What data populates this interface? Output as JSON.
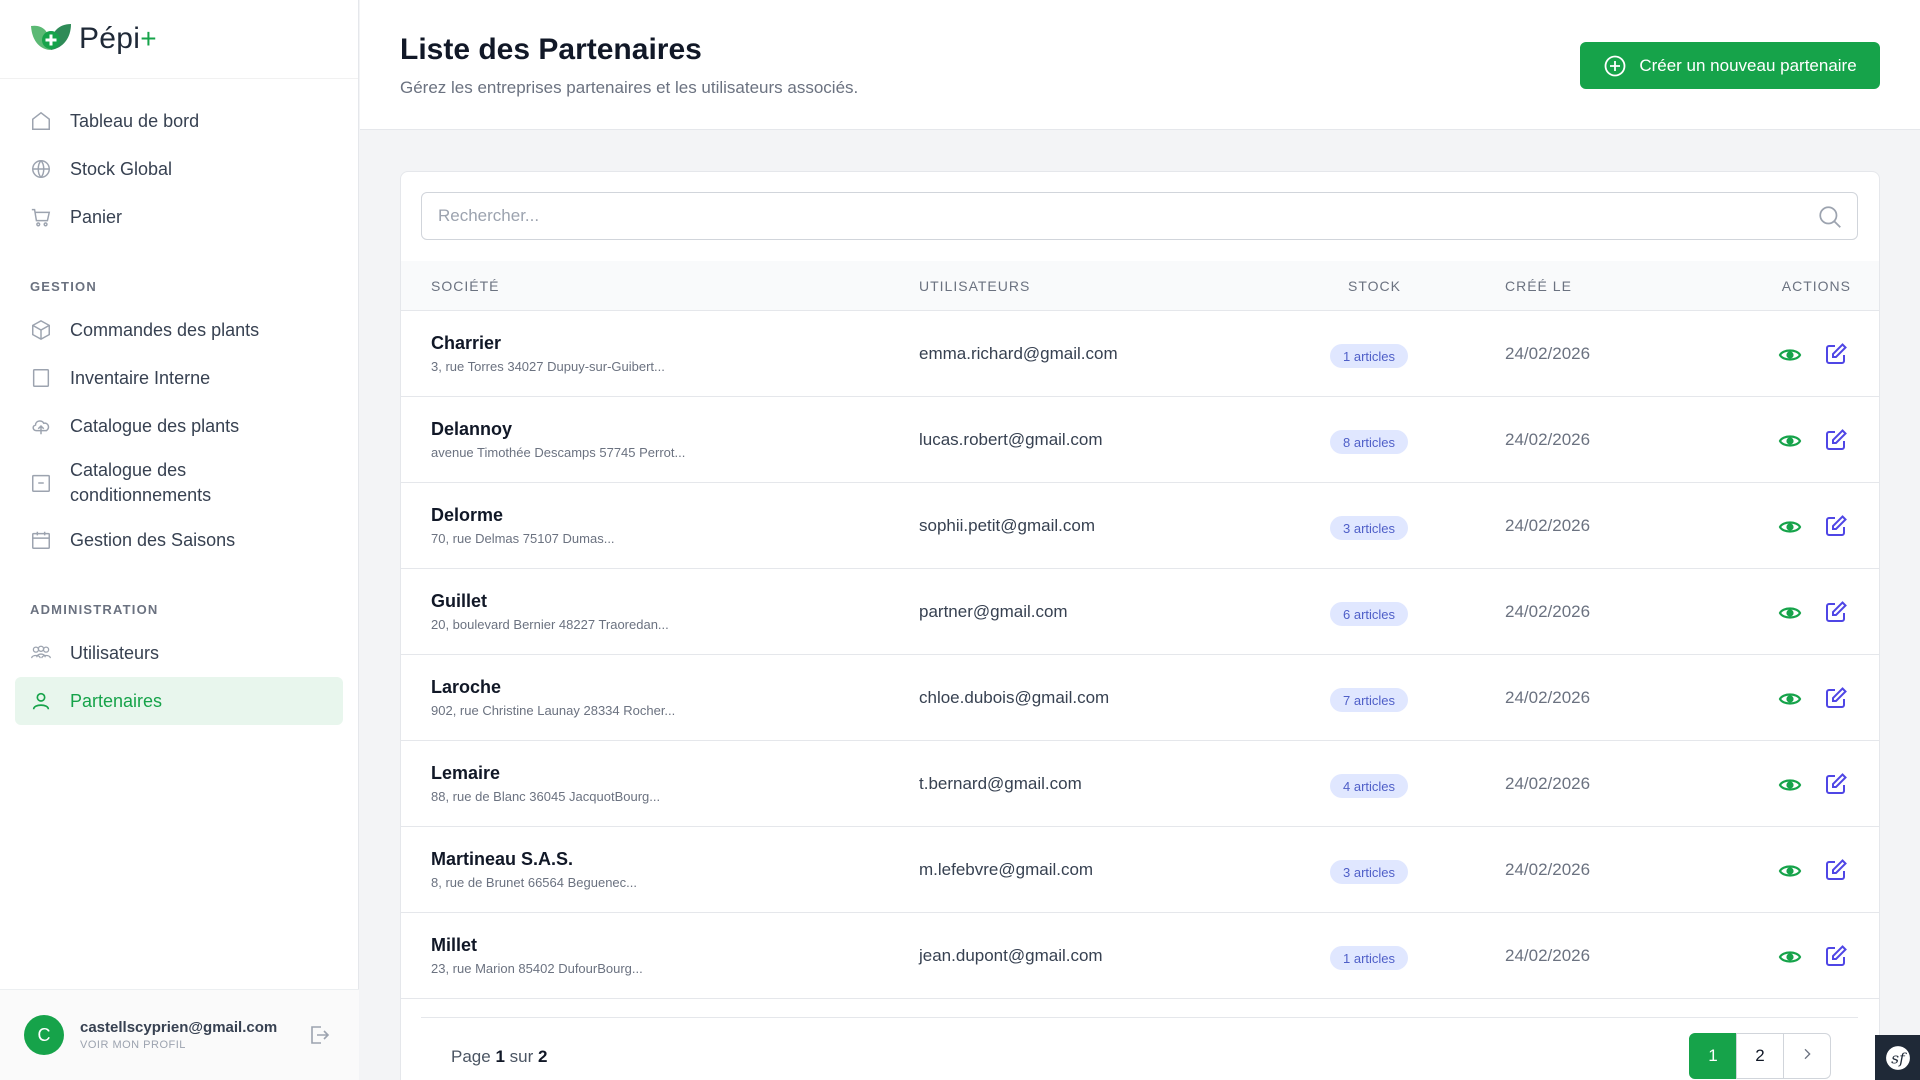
{
  "app": {
    "logo_text": "Pépi",
    "logo_plus": "+"
  },
  "sidebar": {
    "main_items": [
      {
        "label": "Tableau de bord",
        "icon": "home-icon"
      },
      {
        "label": "Stock Global",
        "icon": "globe-icon"
      },
      {
        "label": "Panier",
        "icon": "cart-icon"
      }
    ],
    "section_gestion": "GESTION",
    "gestion_items": [
      {
        "label": "Commandes des plants",
        "icon": "box-icon"
      },
      {
        "label": "Inventaire Interne",
        "icon": "square-icon"
      },
      {
        "label": "Catalogue des plants",
        "icon": "cloud-icon"
      },
      {
        "label": "Catalogue des conditionnements",
        "icon": "package-icon"
      },
      {
        "label": "Gestion des Saisons",
        "icon": "calendar-icon"
      }
    ],
    "section_admin": "ADMINISTRATION",
    "admin_items": [
      {
        "label": "Utilisateurs",
        "icon": "users-icon"
      },
      {
        "label": "Partenaires",
        "icon": "user-icon",
        "active": true
      }
    ]
  },
  "user": {
    "initial": "C",
    "email": "castellscyprien@gmail.com",
    "profile_link": "VOIR MON PROFIL"
  },
  "header": {
    "title": "Liste des Partenaires",
    "subtitle": "Gérez les entreprises partenaires et les utilisateurs associés.",
    "create_button": "Créer un nouveau partenaire"
  },
  "search": {
    "placeholder": "Rechercher..."
  },
  "table": {
    "headers": {
      "societe": "SOCIÉTÉ",
      "utilisateurs": "UTILISATEURS",
      "stock": "STOCK",
      "cree_le": "CRÉÉ LE",
      "actions": "ACTIONS"
    },
    "rows": [
      {
        "name": "Charrier",
        "address": "3, rue Torres 34027 Dupuy-sur-Guibert...",
        "email": "emma.richard@gmail.com",
        "stock": "1 articles",
        "date": "24/02/2026"
      },
      {
        "name": "Delannoy",
        "address": "avenue Timothée Descamps 57745 Perrot...",
        "email": "lucas.robert@gmail.com",
        "stock": "8 articles",
        "date": "24/02/2026"
      },
      {
        "name": "Delorme",
        "address": "70, rue Delmas 75107 Dumas...",
        "email": "sophii.petit@gmail.com",
        "stock": "3 articles",
        "date": "24/02/2026"
      },
      {
        "name": "Guillet",
        "address": "20, boulevard Bernier 48227 Traoredan...",
        "email": "partner@gmail.com",
        "stock": "6 articles",
        "date": "24/02/2026"
      },
      {
        "name": "Laroche",
        "address": "902, rue Christine Launay 28334 Rocher...",
        "email": "chloe.dubois@gmail.com",
        "stock": "7 articles",
        "date": "24/02/2026"
      },
      {
        "name": "Lemaire",
        "address": "88, rue de Blanc 36045 JacquotBourg...",
        "email": "t.bernard@gmail.com",
        "stock": "4 articles",
        "date": "24/02/2026"
      },
      {
        "name": "Martineau S.A.S.",
        "address": "8, rue de Brunet 66564 Beguenec...",
        "email": "m.lefebvre@gmail.com",
        "stock": "3 articles",
        "date": "24/02/2026"
      },
      {
        "name": "Millet",
        "address": "23, rue Marion 85402 DufourBourg...",
        "email": "jean.dupont@gmail.com",
        "stock": "1 articles",
        "date": "24/02/2026"
      }
    ]
  },
  "pagination": {
    "prefix": "Page",
    "current": "1",
    "middle": "sur",
    "total": "2",
    "pages": [
      "1",
      "2"
    ],
    "next_icon": "chevron-right-icon"
  },
  "colors": {
    "accent": "#16a34a",
    "active_bg": "#e8f6ed",
    "badge_bg": "#e0e7ff",
    "edit_icon": "#4f46e5"
  }
}
